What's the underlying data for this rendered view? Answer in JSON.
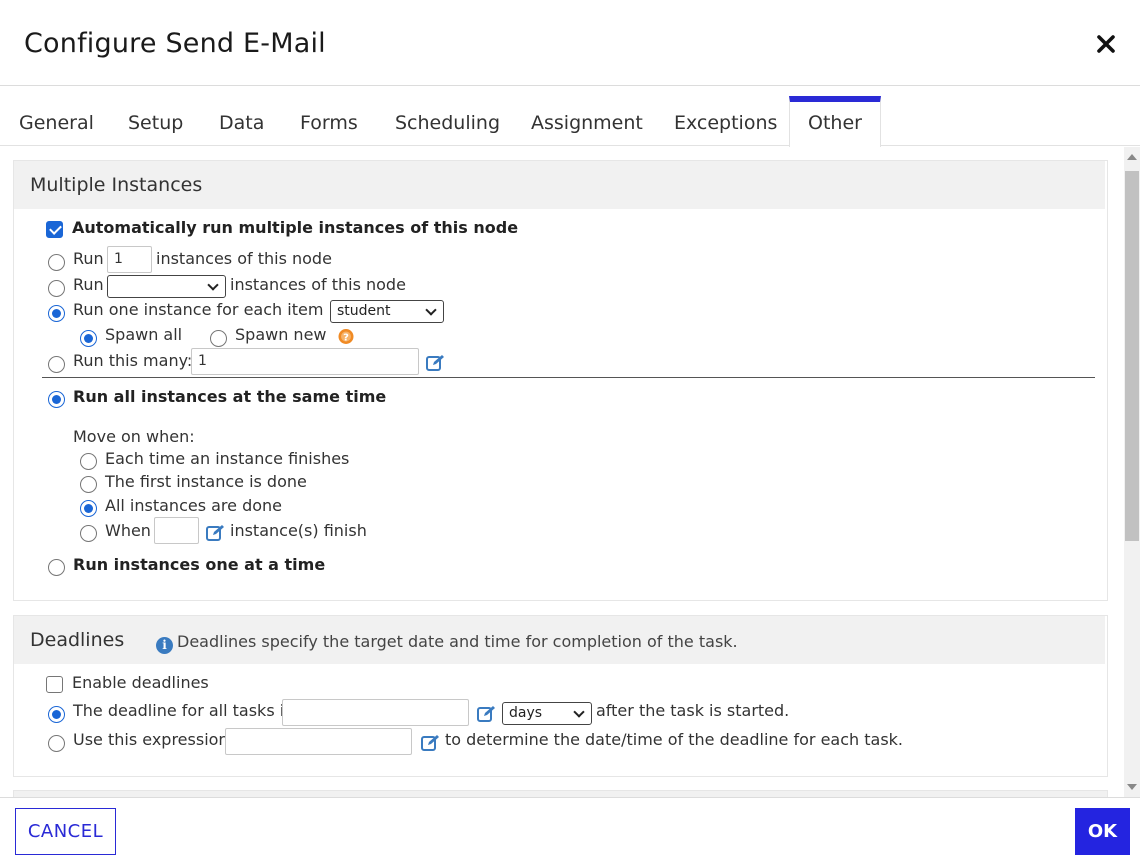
{
  "dialog": {
    "title": "Configure Send E-Mail",
    "close_icon": "close-icon"
  },
  "tabs": [
    {
      "label": "General"
    },
    {
      "label": "Setup"
    },
    {
      "label": "Data"
    },
    {
      "label": "Forms"
    },
    {
      "label": "Scheduling"
    },
    {
      "label": "Assignment"
    },
    {
      "label": "Exceptions"
    },
    {
      "label": "Other",
      "active": true
    }
  ],
  "multiple_instances": {
    "title": "Multiple Instances",
    "auto_run": {
      "label": "Automatically run multiple instances of this node",
      "checked": true
    },
    "run_count": {
      "prefix": "Run",
      "value": "1",
      "suffix": "instances of this node",
      "selected": false
    },
    "run_select": {
      "prefix": "Run",
      "value": "",
      "suffix": "instances of this node",
      "selected": false
    },
    "run_each": {
      "prefix": "Run one instance for each item in",
      "value": "student",
      "selected": true
    },
    "spawn_all": {
      "label": "Spawn all",
      "selected": true
    },
    "spawn_new": {
      "label": "Spawn new",
      "selected": false
    },
    "run_many": {
      "prefix": "Run this many:",
      "value": "1",
      "selected": false
    },
    "same_time": {
      "label": "Run all instances at the same time",
      "selected": true
    },
    "move_on_label": "Move on when:",
    "move_on": [
      {
        "label": "Each time an instance finishes",
        "selected": false
      },
      {
        "label": "The first instance is done",
        "selected": false
      },
      {
        "label": "All instances are done",
        "selected": true
      }
    ],
    "when": {
      "prefix": "When",
      "value": "",
      "suffix": "instance(s) finish",
      "selected": false
    },
    "one_at_a_time": {
      "label": "Run instances one at a time",
      "selected": false
    }
  },
  "deadlines": {
    "title": "Deadlines",
    "note": "Deadlines specify the target date and time for completion of the task.",
    "enable": {
      "label": "Enable deadlines",
      "checked": false
    },
    "fixed": {
      "prefix": "The deadline for all tasks is",
      "value": "",
      "unit": "days",
      "suffix": "after the task is started.",
      "selected": true
    },
    "expression": {
      "prefix": "Use this expression",
      "value": "",
      "suffix": "to determine the date/time of the deadline for each task.",
      "selected": false
    }
  },
  "footer": {
    "cancel_label": "CANCEL",
    "ok_label": "OK"
  },
  "colors": {
    "accent": "#2a2ad6",
    "radio": "#1a66d6",
    "edit_icon": "#3a7bc0",
    "info_icon": "#3a7bc0",
    "warning_icon": "#f08a24"
  }
}
